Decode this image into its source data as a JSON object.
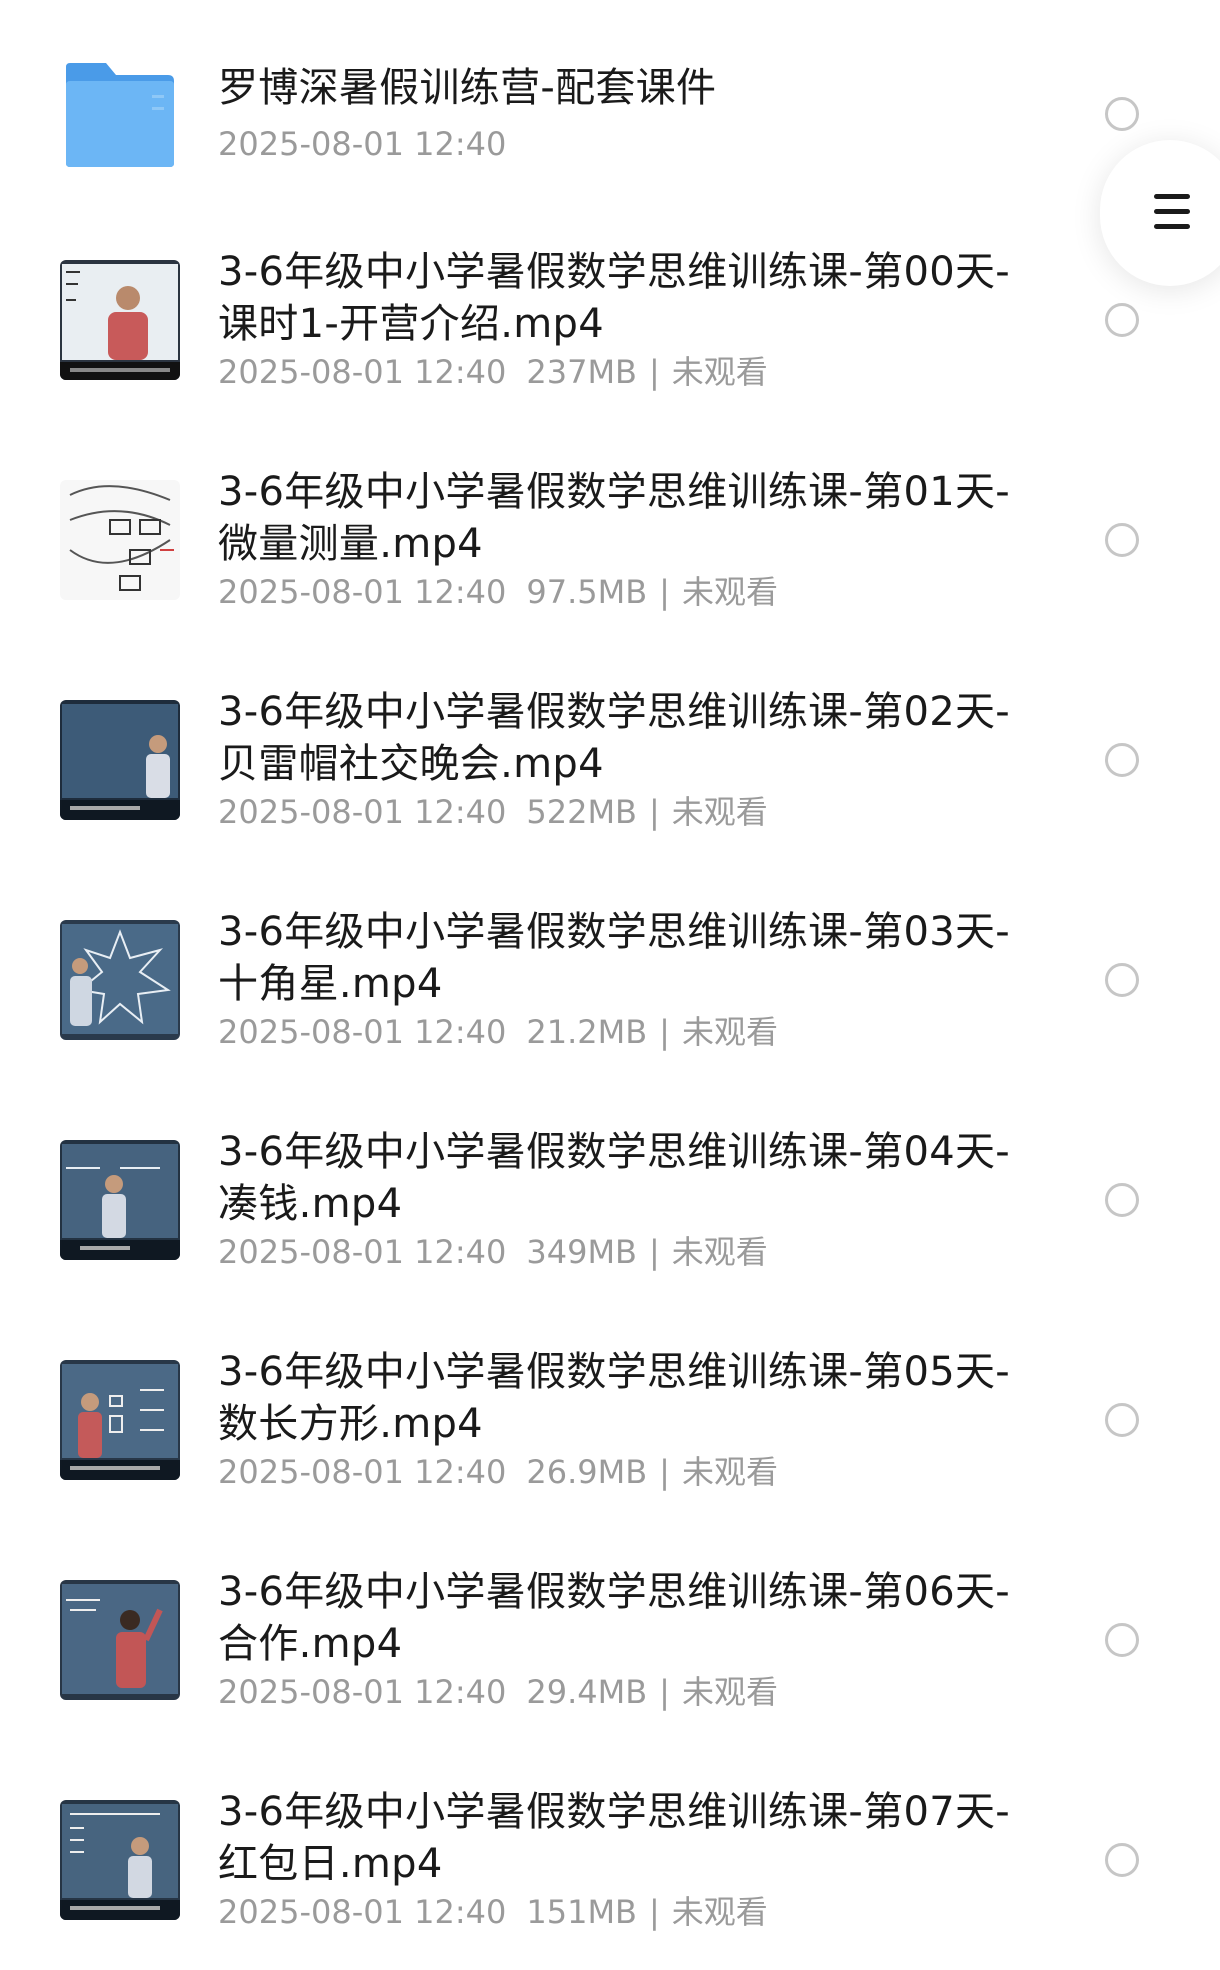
{
  "folder": {
    "name": "罗博深暑假训练营-配套课件",
    "date": "2025-08-01 12:40",
    "icon": "folder-icon",
    "color": "#5aaaf2"
  },
  "menu": {
    "icon": "menu-icon"
  },
  "files": [
    {
      "title": "3-6年级中小学暑假数学思维训练课-第00天-\n课时1-开营介绍.mp4",
      "date": "2025-08-01 12:40",
      "size": "237MB",
      "status": "未观看"
    },
    {
      "title": "3-6年级中小学暑假数学思维训练课-第01天-\n微量测量.mp4",
      "date": "2025-08-01 12:40",
      "size": "97.5MB",
      "status": "未观看"
    },
    {
      "title": "3-6年级中小学暑假数学思维训练课-第02天-\n贝雷帽社交晚会.mp4",
      "date": "2025-08-01 12:40",
      "size": "522MB",
      "status": "未观看"
    },
    {
      "title": "3-6年级中小学暑假数学思维训练课-第03天-\n十角星.mp4",
      "date": "2025-08-01 12:40",
      "size": "21.2MB",
      "status": "未观看"
    },
    {
      "title": "3-6年级中小学暑假数学思维训练课-第04天-\n凑钱.mp4",
      "date": "2025-08-01 12:40",
      "size": "349MB",
      "status": "未观看"
    },
    {
      "title": "3-6年级中小学暑假数学思维训练课-第05天-\n数长方形.mp4",
      "date": "2025-08-01 12:40",
      "size": "26.9MB",
      "status": "未观看"
    },
    {
      "title": "3-6年级中小学暑假数学思维训练课-第06天-\n 合作.mp4",
      "date": "2025-08-01 12:40",
      "size": "29.4MB",
      "status": "未观看"
    },
    {
      "title": "3-6年级中小学暑假数学思维训练课-第07天-\n红包日.mp4",
      "date": "2025-08-01 12:40",
      "size": "151MB",
      "status": "未观看"
    }
  ]
}
